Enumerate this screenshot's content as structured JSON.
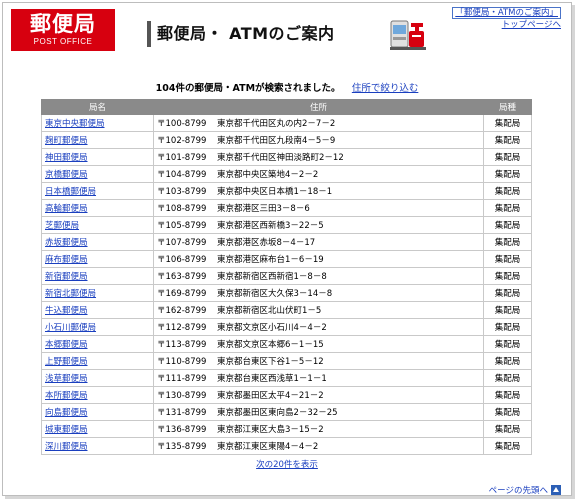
{
  "header": {
    "logo_main": "郵便局",
    "logo_sub": "POST OFFICE",
    "page_title": "郵便局・ ATMのご案内",
    "links": [
      "「郵便局・ATMのご案内」",
      "トップページへ"
    ]
  },
  "summary": {
    "text": "104件の郵便局・ATMが検索されました。",
    "refine_link": "住所で絞り込む"
  },
  "table": {
    "headers": [
      "局名",
      "住所",
      "局種"
    ],
    "rows": [
      {
        "name": "東京中央郵便局",
        "zip": "〒100-8799",
        "address": "東京都千代田区丸の内2－7－2",
        "type": "集配局"
      },
      {
        "name": "麹町郵便局",
        "zip": "〒102-8799",
        "address": "東京都千代田区九段南4－5－9",
        "type": "集配局"
      },
      {
        "name": "神田郵便局",
        "zip": "〒101-8799",
        "address": "東京都千代田区神田淡路町2－12",
        "type": "集配局"
      },
      {
        "name": "京橋郵便局",
        "zip": "〒104-8799",
        "address": "東京都中央区築地4－2－2",
        "type": "集配局"
      },
      {
        "name": "日本橋郵便局",
        "zip": "〒103-8799",
        "address": "東京都中央区日本橋1－18－1",
        "type": "集配局"
      },
      {
        "name": "高輪郵便局",
        "zip": "〒108-8799",
        "address": "東京都港区三田3－8－6",
        "type": "集配局"
      },
      {
        "name": "芝郵便局",
        "zip": "〒105-8799",
        "address": "東京都港区西新橋3－22－5",
        "type": "集配局"
      },
      {
        "name": "赤坂郵便局",
        "zip": "〒107-8799",
        "address": "東京都港区赤坂8－4－17",
        "type": "集配局"
      },
      {
        "name": "麻布郵便局",
        "zip": "〒106-8799",
        "address": "東京都港区麻布台1－6－19",
        "type": "集配局"
      },
      {
        "name": "新宿郵便局",
        "zip": "〒163-8799",
        "address": "東京都新宿区西新宿1－8－8",
        "type": "集配局"
      },
      {
        "name": "新宿北郵便局",
        "zip": "〒169-8799",
        "address": "東京都新宿区大久保3－14－8",
        "type": "集配局"
      },
      {
        "name": "牛込郵便局",
        "zip": "〒162-8799",
        "address": "東京都新宿区北山伏町1－5",
        "type": "集配局"
      },
      {
        "name": "小石川郵便局",
        "zip": "〒112-8799",
        "address": "東京都文京区小石川4－4－2",
        "type": "集配局"
      },
      {
        "name": "本郷郵便局",
        "zip": "〒113-8799",
        "address": "東京都文京区本郷6－1－15",
        "type": "集配局"
      },
      {
        "name": "上野郵便局",
        "zip": "〒110-8799",
        "address": "東京都台東区下谷1－5－12",
        "type": "集配局"
      },
      {
        "name": "浅草郵便局",
        "zip": "〒111-8799",
        "address": "東京都台東区西浅草1－1－1",
        "type": "集配局"
      },
      {
        "name": "本所郵便局",
        "zip": "〒130-8799",
        "address": "東京都墨田区太平4－21－2",
        "type": "集配局"
      },
      {
        "name": "向島郵便局",
        "zip": "〒131-8799",
        "address": "東京都墨田区東向島2－32－25",
        "type": "集配局"
      },
      {
        "name": "城東郵便局",
        "zip": "〒136-8799",
        "address": "東京都江東区大島3－15－2",
        "type": "集配局"
      },
      {
        "name": "深川郵便局",
        "zip": "〒135-8799",
        "address": "東京都江東区東陽4－4－2",
        "type": "集配局"
      }
    ]
  },
  "pagination": {
    "next_label": "次の20件を表示"
  },
  "footer": {
    "page_top_label": "ページの先頭へ"
  },
  "colors": {
    "brand_red": "#d7000f",
    "link_blue": "#1a3fbf",
    "header_gray": "#8a8a8a"
  }
}
